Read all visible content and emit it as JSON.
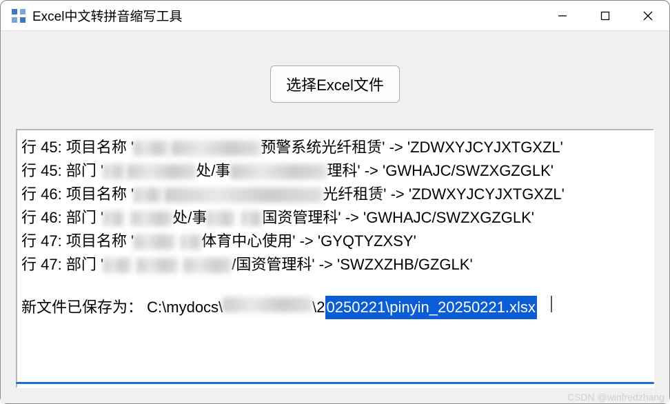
{
  "window": {
    "title": "Excel中文转拼音缩写工具"
  },
  "main": {
    "choose_button": "选择Excel文件"
  },
  "log": {
    "lines": [
      {
        "row": "45",
        "field": "项目名称",
        "suffix": "预警系统光纤租赁",
        "arrow": "->",
        "result": "ZDWXYJCYJXTGXZL"
      },
      {
        "row": "45",
        "field": "部门",
        "mid": "处/事",
        "suffix": "理科",
        "arrow": "->",
        "result": "GWHAJC/SWZXGZGLK"
      },
      {
        "row": "46",
        "field": "项目名称",
        "suffix": "光纤租赁",
        "arrow": "->",
        "result": "ZDWXYJCYJXTGXZL"
      },
      {
        "row": "46",
        "field": "部门",
        "mid": "处/事",
        "suffix": "国资管理科",
        "arrow": "->",
        "result": "GWHAJC/SWZXGZGLK"
      },
      {
        "row": "47",
        "field": "项目名称",
        "suffix": "体育中心使用",
        "arrow": "->",
        "result": "GYQTYZXSY"
      },
      {
        "row": "47",
        "field": "部门",
        "mid": "/国资管理科",
        "arrow": "->",
        "result": "SWZXZHB/GZGLK"
      }
    ],
    "save_prefix": "新文件已保存为：",
    "save_path_plain": "C:\\mydocs\\",
    "save_path_suffix": "\\2",
    "save_path_selected": "0250221\\pinyin_20250221.xlsx"
  },
  "labels": {
    "row_prefix": "行",
    "colon": ":",
    "quote": "'"
  },
  "watermark": "CSDN @winfredzhang"
}
